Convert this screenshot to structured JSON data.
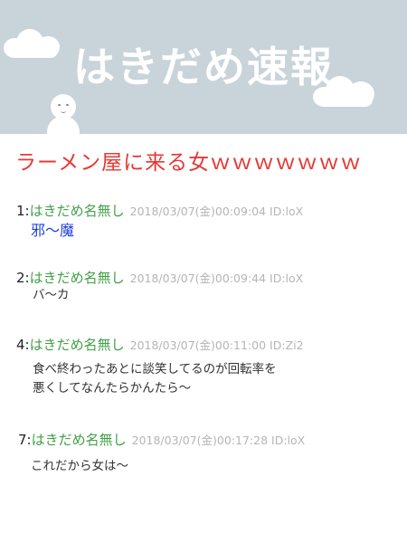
{
  "header": {
    "site_title": "はきだめ速報",
    "background": "#c9d3da"
  },
  "article": {
    "title": "ラーメン屋に来る女ｗｗｗｗｗｗｗ",
    "title_color": "#e53935"
  },
  "posts": [
    {
      "number": "1:",
      "name": "はきだめ名無し",
      "meta": "2018/03/07(金)00:09:04 ID:loX",
      "body": [
        "邪～魔"
      ],
      "body_color": "#1a3fe0"
    },
    {
      "number": "2:",
      "name": "はきだめ名無し",
      "meta": "2018/03/07(金)00:09:44 ID:loX",
      "body": [
        "バ～カ"
      ]
    },
    {
      "number": "4:",
      "name": "はきだめ名無し",
      "meta": "2018/03/07(金)00:11:00 ID:Zi2",
      "body": [
        "食べ終わったあとに談笑してるのが回転率を",
        "悪くしてなんたらかんたら～"
      ]
    },
    {
      "number": "7:",
      "name": "はきだめ名無し",
      "meta": "2018/03/07(金)00:17:28 ID:loX",
      "body": [
        "これだから女は～"
      ]
    }
  ],
  "colors": {
    "name": "#43a047",
    "meta": "#b5b5b5",
    "body": "#333333"
  }
}
